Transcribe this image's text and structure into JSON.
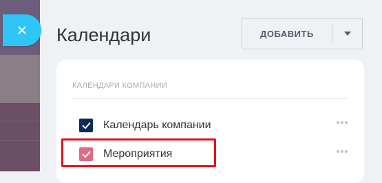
{
  "header": {
    "title": "Календари",
    "add_button_label": "ДОБАВИТЬ"
  },
  "section": {
    "title": "КАЛЕНДАРИ КОМПАНИИ",
    "calendars": [
      {
        "label": "Календарь компании",
        "color": "#0b2a57",
        "checked": true
      },
      {
        "label": "Мероприятия",
        "color": "#de6b87",
        "checked": true
      }
    ]
  },
  "colors": {
    "close_button": "#2fc6f6",
    "highlight_border": "#e0101b"
  },
  "icons": {
    "close": "close-icon",
    "dropdown": "chevron-down-icon",
    "check": "check-icon",
    "more": "more-dots-icon"
  }
}
